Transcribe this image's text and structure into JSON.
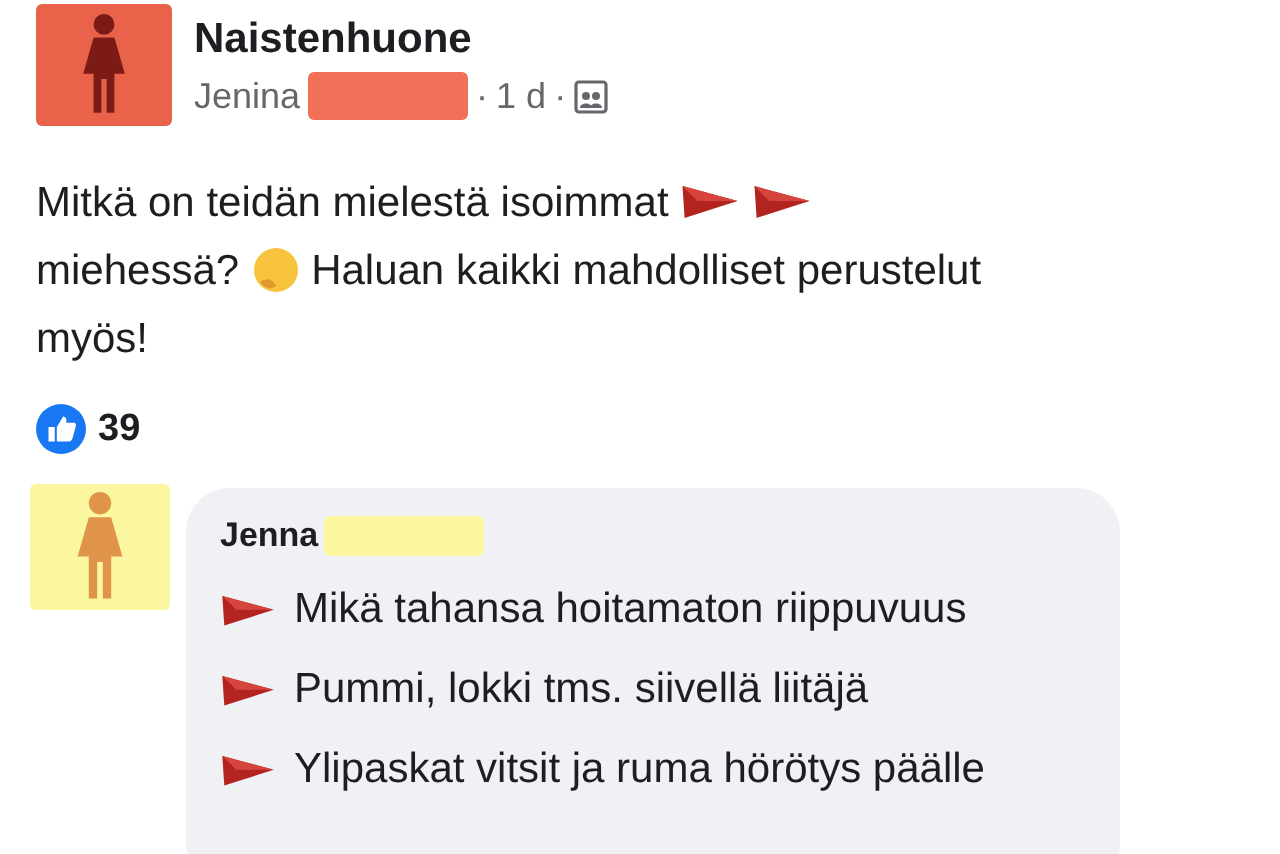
{
  "post": {
    "group": "Naistenhuone",
    "author": "Jenina",
    "separator": "·",
    "time": "1 d",
    "lines": [
      [
        {
          "kind": "text",
          "text": "Mitkä on teidän mielestä isoimmat"
        },
        {
          "kind": "flag"
        },
        {
          "kind": "flag"
        }
      ],
      [
        {
          "kind": "text",
          "text": "miehessä?"
        },
        {
          "kind": "emoji"
        },
        {
          "kind": "text",
          "text": "Haluan kaikki mahdolliset perustelut"
        }
      ],
      [
        {
          "kind": "text",
          "text": "myös!"
        }
      ]
    ],
    "likes": "39"
  },
  "comment": {
    "author": "Jenna",
    "items": [
      {
        "text": "Mikä tahansa hoitamaton riippuvuus"
      },
      {
        "text": "Pummi, lokki tms. siivellä liitäjä"
      },
      {
        "text": "Ylipaskat vitsit ja ruma hörötys päälle"
      }
    ]
  }
}
